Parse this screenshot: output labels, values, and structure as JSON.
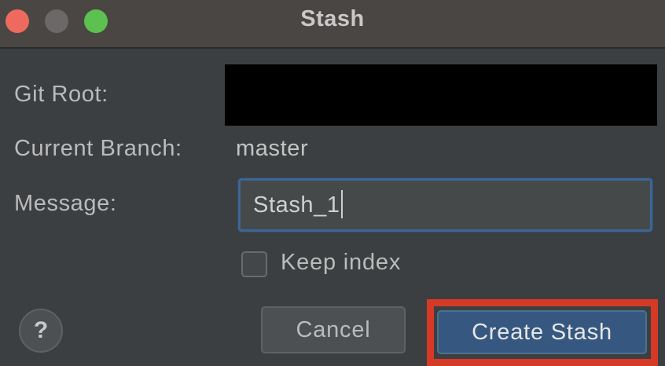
{
  "window": {
    "title": "Stash"
  },
  "form": {
    "git_root_label": "Git Root:",
    "current_branch_label": "Current Branch:",
    "current_branch_value": "master",
    "message_label": "Message:",
    "message_value": "Stash_1",
    "keep_index_label": "Keep index",
    "keep_index_checked": false
  },
  "buttons": {
    "help_label": "?",
    "cancel_label": "Cancel",
    "create_label": "Create Stash"
  },
  "colors": {
    "background": "#3c3f41",
    "titlebar": "#4a4644",
    "primary_button": "#365880",
    "focus_border": "#3f6592",
    "highlight_frame": "#d63a26",
    "close": "#ee6a5f",
    "minimize": "#6b6867",
    "zoom": "#5dc150"
  }
}
